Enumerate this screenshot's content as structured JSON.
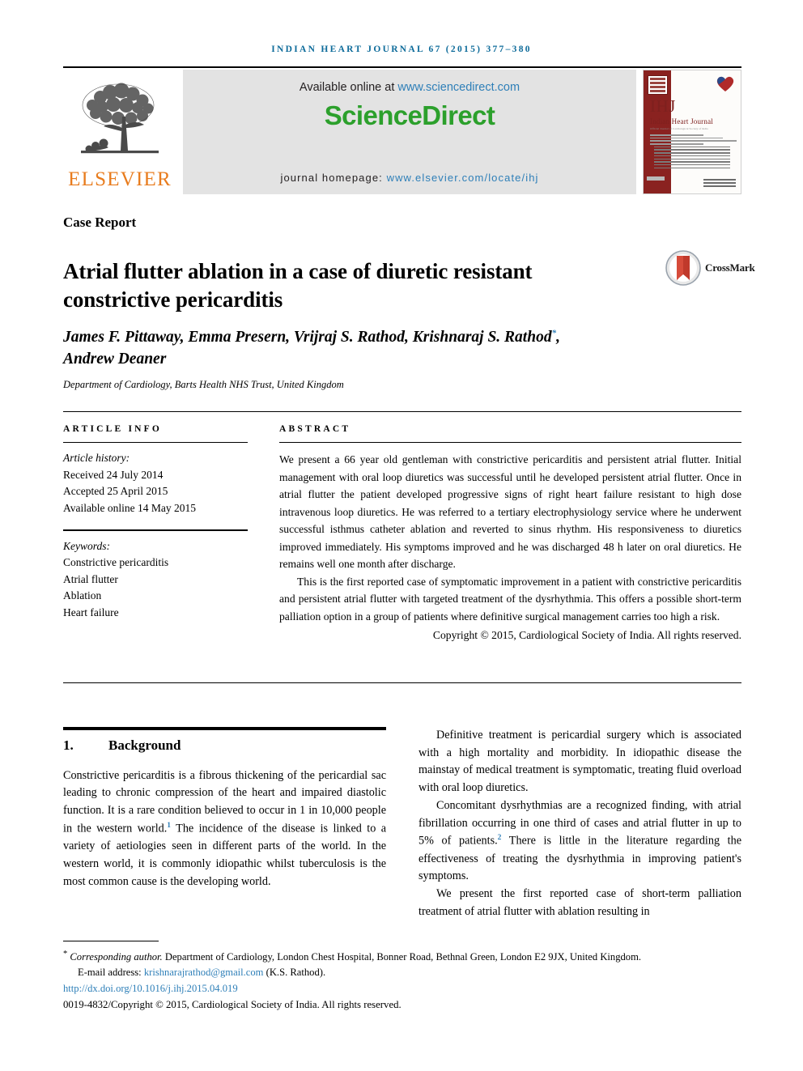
{
  "running_head": "Indian Heart Journal 67 (2015) 377–380",
  "masthead": {
    "elsevier_wordmark": "ELSEVIER",
    "available_prefix": "Available online at ",
    "available_url": "www.sciencedirect.com",
    "sciencedirect_logo": "ScienceDirect",
    "homepage_prefix": "journal homepage: ",
    "homepage_url": "www.elsevier.com/locate/ihj",
    "cover": {
      "initials": "IHJ",
      "name": "Indian Heart Journal",
      "tagline": "Official Journal of Cardiological Society of India"
    },
    "colors": {
      "sciencedirect_green": "#2ca02c",
      "link_blue": "#2e7fb8",
      "elsevier_orange": "#E87C1E",
      "banner_grey": "#e3e3e3",
      "cover_maroon": "#8a2220",
      "running_head_blue": "#0d6b9a"
    }
  },
  "article": {
    "type": "Case Report",
    "title": "Atrial flutter ablation in a case of diuretic resistant constrictive pericarditis",
    "authors": "James F. Pittaway, Emma Presern, Vrijraj S. Rathod, Krishnaraj S. Rathod",
    "authors_line2": "Andrew Deaner",
    "corresponding_marker": "*",
    "affiliation": "Department of Cardiology, Barts Health NHS Trust, United Kingdom",
    "crossmark_label": "CrossMark"
  },
  "article_info": {
    "heading": "ARTICLE INFO",
    "history_label": "Article history:",
    "received": "Received 24 July 2014",
    "accepted": "Accepted 25 April 2015",
    "available_online": "Available online 14 May 2015",
    "keywords_label": "Keywords:",
    "keywords": [
      "Constrictive pericarditis",
      "Atrial flutter",
      "Ablation",
      "Heart failure"
    ]
  },
  "abstract": {
    "heading": "ABSTRACT",
    "paragraph_1": "We present a 66 year old gentleman with constrictive pericarditis and persistent atrial flutter. Initial management with oral loop diuretics was successful until he developed persistent atrial flutter. Once in atrial flutter the patient developed progressive signs of right heart failure resistant to high dose intravenous loop diuretics. He was referred to a tertiary electrophysiology service where he underwent successful isthmus catheter ablation and reverted to sinus rhythm. His responsiveness to diuretics improved immediately. His symptoms improved and he was discharged 48 h later on oral diuretics. He remains well one month after discharge.",
    "paragraph_2": "This is the first reported case of symptomatic improvement in a patient with constrictive pericarditis and persistent atrial flutter with targeted treatment of the dysrhythmia. This offers a possible short-term palliation option in a group of patients where definitive surgical management carries too high a risk.",
    "copyright": "Copyright © 2015, Cardiological Society of India. All rights reserved."
  },
  "body": {
    "section_number": "1.",
    "section_title": "Background",
    "left_paragraph_1_a": "Constrictive pericarditis is a fibrous thickening of the pericardial sac leading to chronic compression of the heart and impaired diastolic function. It is a rare condition believed to occur in 1 in 10,000 people in the western world.",
    "left_paragraph_1_ref": "1",
    "left_paragraph_1_b": " The incidence of the disease is linked to a variety of aetiologies seen in different parts of the world. In the western world, it is commonly idiopathic whilst tuberculosis is the most common cause is the developing world.",
    "right_paragraph_1": "Definitive treatment is pericardial surgery which is associated with a high mortality and morbidity. In idiopathic disease the mainstay of medical treatment is symptomatic, treating fluid overload with oral loop diuretics.",
    "right_paragraph_2_a": "Concomitant dysrhythmias are a recognized finding, with atrial fibrillation occurring in one third of cases and atrial flutter in up to 5% of patients.",
    "right_paragraph_2_ref": "2",
    "right_paragraph_2_b": " There is little in the literature regarding the effectiveness of treating the dysrhythmia in improving patient's symptoms.",
    "right_paragraph_3": "We present the first reported case of short-term palliation treatment of atrial flutter with ablation resulting in"
  },
  "footnote": {
    "corresponding_marker": "*",
    "corresponding_label": "Corresponding author.",
    "corresponding_address": " Department of Cardiology, London Chest Hospital, Bonner Road, Bethnal Green, London E2 9JX, United Kingdom.",
    "email_label": "E-mail address: ",
    "email": "krishnarajrathod@gmail.com",
    "email_attrib": " (K.S. Rathod).",
    "doi": "http://dx.doi.org/10.1016/j.ihj.2015.04.019",
    "issn_line": "0019-4832/Copyright © 2015, Cardiological Society of India. All rights reserved."
  }
}
